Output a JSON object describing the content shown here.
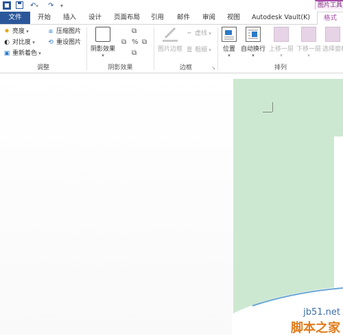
{
  "quick_access": {
    "undo_label": "↶",
    "redo_label": "↷",
    "more_label": "▾"
  },
  "context_tab_group": "图片工具",
  "tabs": {
    "file": "文件",
    "items": [
      "开始",
      "插入",
      "设计",
      "页面布局",
      "引用",
      "邮件",
      "审阅",
      "视图",
      "Autodesk Vault(K)"
    ],
    "format": "格式"
  },
  "adjust_group": {
    "brightness": "亮度",
    "contrast": "对比度",
    "recolor": "重新着色",
    "compress": "压缩图片",
    "reset": "重设图片",
    "label": "调整"
  },
  "shadow_group": {
    "button": "阴影效果",
    "label": "阴影效果"
  },
  "border_group": {
    "picture_border": "图片边框",
    "dashes": "虚线",
    "weight": "粗细",
    "label": "边框"
  },
  "arrange_group": {
    "position": "位置",
    "wrap_text": "自动换行",
    "bring_forward": "上移一层",
    "send_backward": "下移一层",
    "selection_pane": "选择窗格",
    "label": "排列"
  },
  "watermark": {
    "url": "jb51.net",
    "text": "脚本之家"
  },
  "colors": {
    "file_tab": "#2b579a",
    "format_tab": "#a84aa8",
    "page": "#cde8d1",
    "watermark_text": "#e07b1a",
    "watermark_url": "#3c6fa8"
  }
}
